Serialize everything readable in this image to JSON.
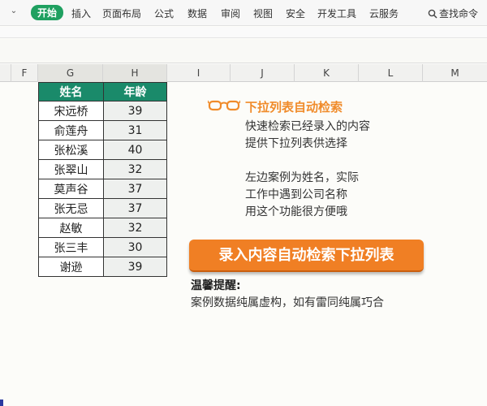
{
  "menu": {
    "collapse_glyph": "⌄",
    "items": [
      "开始",
      "插入",
      "页面布局",
      "公式",
      "数据",
      "审阅",
      "视图",
      "安全",
      "开发工具",
      "云服务"
    ],
    "search_label": "查找命令"
  },
  "columns": [
    "F",
    "G",
    "H",
    "I",
    "J",
    "K",
    "L",
    "M"
  ],
  "table": {
    "headers": [
      "姓名",
      "年龄"
    ],
    "rows": [
      [
        "宋远桥",
        "39"
      ],
      [
        "俞莲舟",
        "31"
      ],
      [
        "张松溪",
        "40"
      ],
      [
        "张翠山",
        "32"
      ],
      [
        "莫声谷",
        "37"
      ],
      [
        "张无忌",
        "37"
      ],
      [
        "赵敏",
        "32"
      ],
      [
        "张三丰",
        "30"
      ],
      [
        "谢逊",
        "39"
      ]
    ]
  },
  "tip": {
    "title": "下拉列表自动检索",
    "lines": [
      "快速检索已经录入的内容",
      "提供下拉列表供选择",
      "",
      "左边案例为姓名，实际",
      "工作中遇到公司名称",
      "用这个功能很方便哦"
    ]
  },
  "button_label": "录入内容自动检索下拉列表",
  "reminder": {
    "label": "温馨提醒:",
    "text": "案例数据纯属虚构，如有雷同纯属巧合"
  },
  "colors": {
    "menu_active": "#1fa060",
    "table_header": "#1a8a6a",
    "accent_orange": "#f08b2a",
    "button_orange": "#f07f24"
  }
}
